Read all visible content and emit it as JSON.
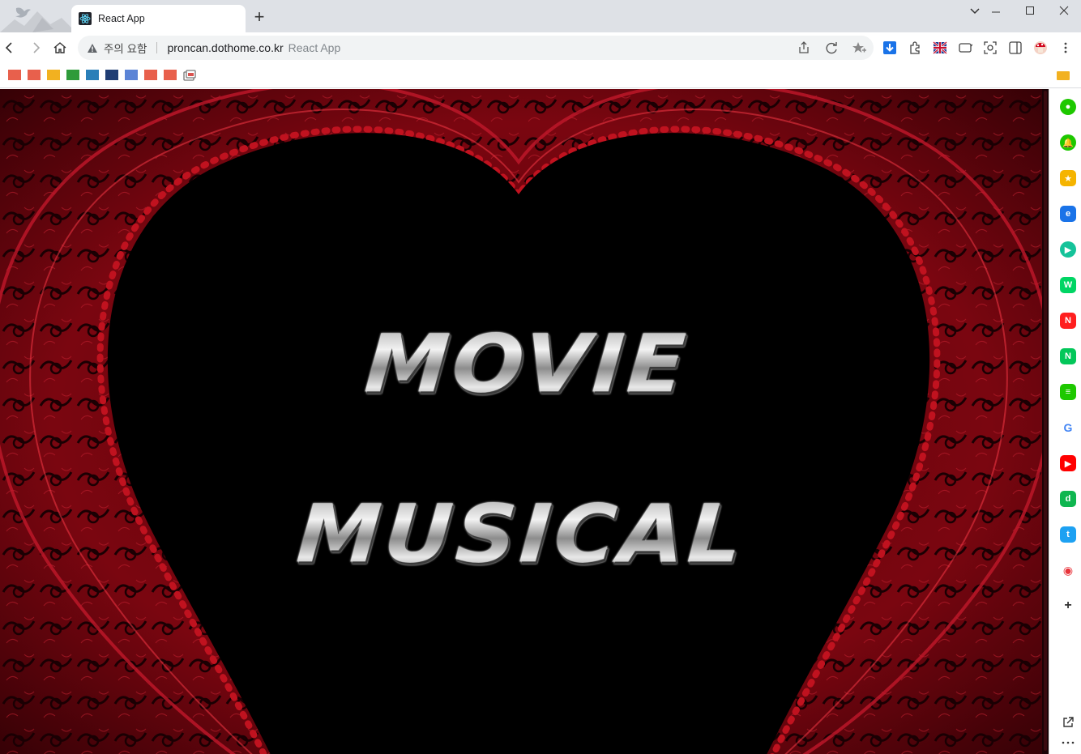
{
  "tab": {
    "title": "React App"
  },
  "toolbar": {
    "security_label": "주의 요함",
    "url": "proncan.dothome.co.kr",
    "page_title_hint": "React App"
  },
  "bookmarks": {
    "folders": [
      {
        "color": "#e8604c"
      },
      {
        "color": "#e8604c"
      },
      {
        "color": "#f2b120"
      },
      {
        "color": "#2e9b3a"
      },
      {
        "color": "#2a7fb8"
      },
      {
        "color": "#1f3d73"
      },
      {
        "color": "#5b84d6"
      },
      {
        "color": "#e8604c"
      },
      {
        "color": "#e8604c"
      }
    ]
  },
  "hero": {
    "line1": "MOVIE",
    "line2": "MUSICAL"
  },
  "sidepanel": {
    "items": [
      {
        "name": "naver-talk-icon",
        "color": "#1ec800",
        "glyph": "●"
      },
      {
        "name": "notification-icon",
        "color": "#1ec800",
        "glyph": "🔔"
      },
      {
        "name": "favorites-icon",
        "color": "#f5b400",
        "glyph": "★"
      },
      {
        "name": "edge-icon",
        "color": "#1a73e8",
        "glyph": "e"
      },
      {
        "name": "play-icon",
        "color": "#15c39a",
        "glyph": "▶"
      },
      {
        "name": "webtoon-icon",
        "color": "#00d564",
        "glyph": "W"
      },
      {
        "name": "now-icon",
        "color": "#ff1f1f",
        "glyph": "N"
      },
      {
        "name": "naver-icon",
        "color": "#03c75a",
        "glyph": "N"
      },
      {
        "name": "memo-icon",
        "color": "#1ec800",
        "glyph": "≡"
      },
      {
        "name": "google-icon",
        "color": "#ffffff",
        "glyph": "G"
      },
      {
        "name": "youtube-icon",
        "color": "#ff0000",
        "glyph": "▶"
      },
      {
        "name": "dict-icon",
        "color": "#0fb650",
        "glyph": "d"
      },
      {
        "name": "twitter-icon",
        "color": "#1da1f2",
        "glyph": "t"
      },
      {
        "name": "record-icon",
        "color": "#ffffff",
        "glyph": "◉"
      },
      {
        "name": "add-icon",
        "color": "#ffffff",
        "glyph": "+"
      }
    ]
  },
  "colors": {
    "accent_red": "#8a0a14",
    "dark_red": "#3a0006"
  }
}
